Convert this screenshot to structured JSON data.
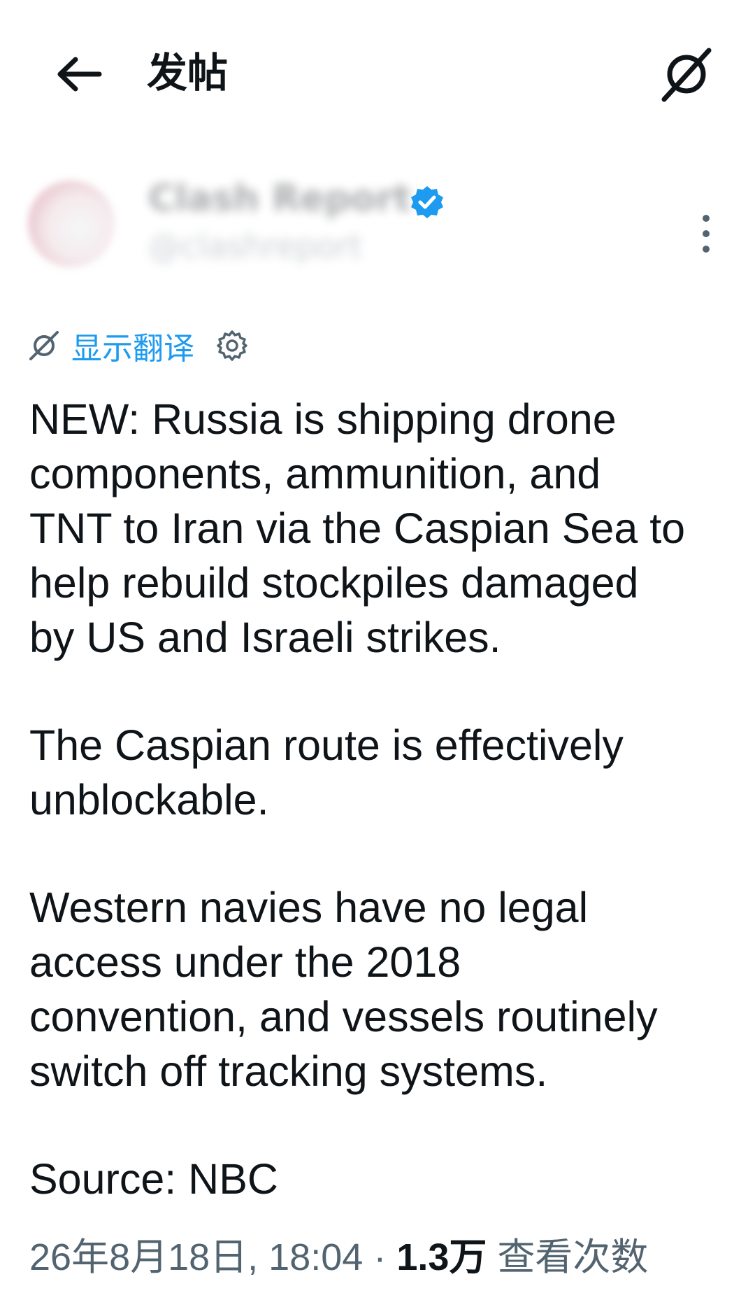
{
  "header": {
    "title": "发帖"
  },
  "author": {
    "name": "Clash Report",
    "handle": "@clashreport",
    "verified_color": "#1d9bf0"
  },
  "translate": {
    "label": "显示翻译"
  },
  "tweet": {
    "paragraphs": [
      "NEW: Russia is shipping drone\ncomponents, ammunition, and\nTNT to Iran via the Caspian Sea to\nhelp rebuild stockpiles damaged\nby US and Israeli strikes.",
      "The Caspian route is effectively\nunblockable.",
      "Western navies have no legal\naccess under the 2018\nconvention, and vessels routinely\nswitch off tracking systems.",
      "Source: NBC"
    ]
  },
  "meta": {
    "timestamp": "26年8月18日, 18:04",
    "separator": " · ",
    "views_count": "1.3万",
    "views_label": " 查看次数"
  },
  "icons": {
    "back": "arrow-left-icon",
    "translate_top": "translate-icon",
    "more": "more-vertical-icon",
    "translate_inline": "translate-icon",
    "settings": "gear-icon",
    "verified": "verified-badge-icon"
  }
}
